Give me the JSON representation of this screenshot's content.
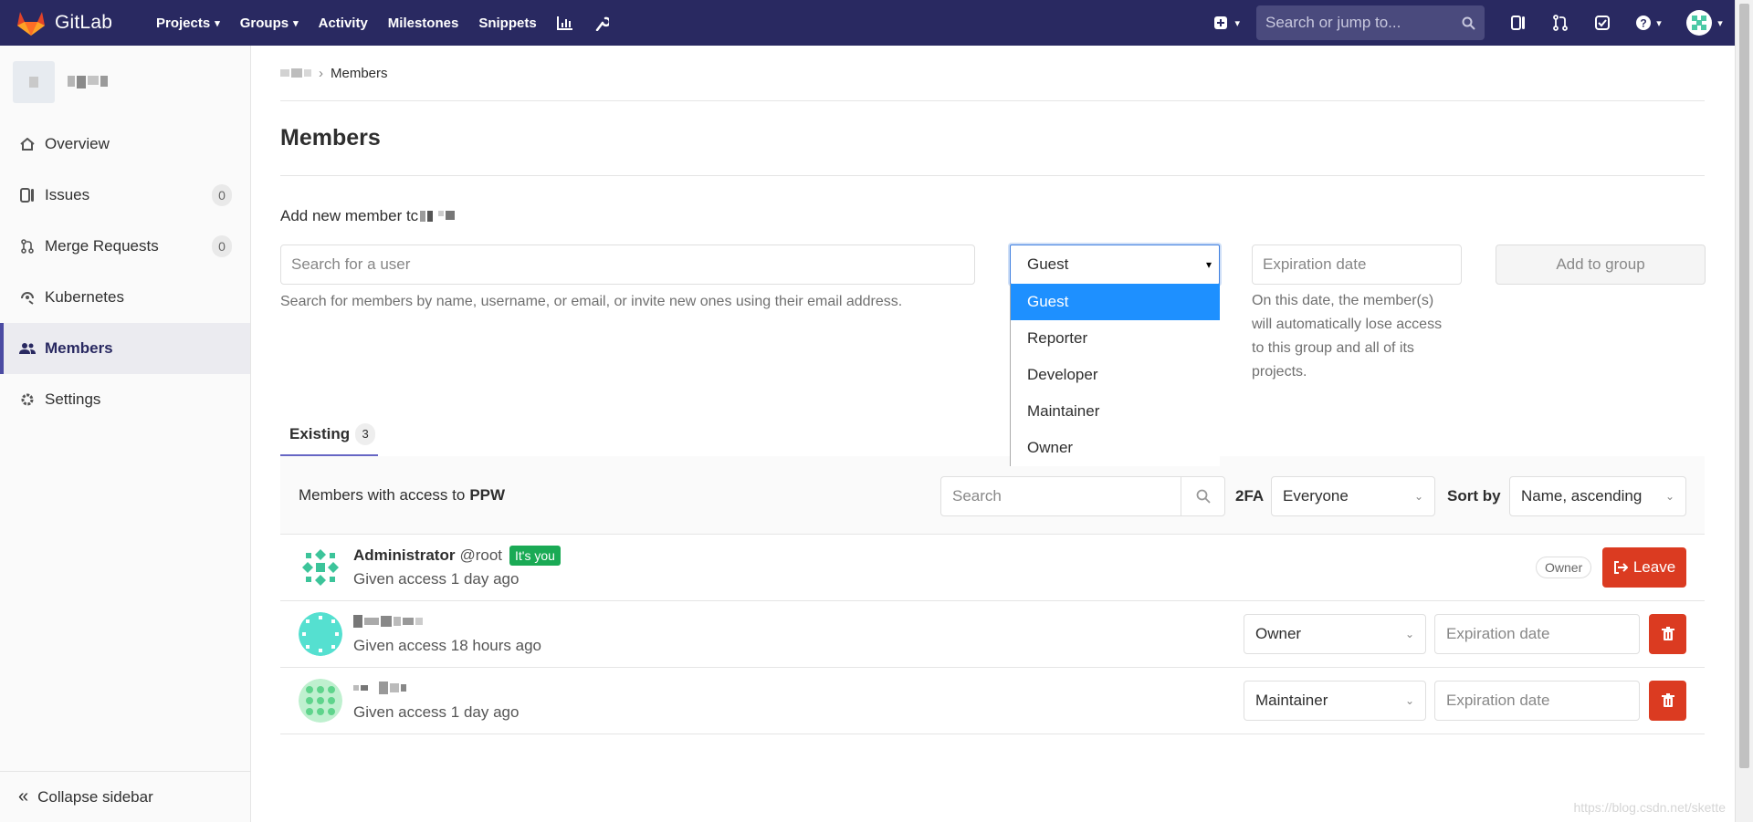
{
  "navbar": {
    "brand": "GitLab",
    "links": [
      {
        "label": "Projects",
        "caret": true
      },
      {
        "label": "Groups",
        "caret": true
      },
      {
        "label": "Activity",
        "caret": false
      },
      {
        "label": "Milestones",
        "caret": false
      },
      {
        "label": "Snippets",
        "caret": false
      }
    ],
    "search_placeholder": "Search or jump to..."
  },
  "sidebar": {
    "items": [
      {
        "label": "Overview",
        "icon": "home-icon"
      },
      {
        "label": "Issues",
        "icon": "issues-icon",
        "count": "0"
      },
      {
        "label": "Merge Requests",
        "icon": "merge-request-icon",
        "count": "0"
      },
      {
        "label": "Kubernetes",
        "icon": "kubernetes-icon"
      },
      {
        "label": "Members",
        "icon": "users-icon",
        "active": true
      },
      {
        "label": "Settings",
        "icon": "settings-icon"
      }
    ],
    "collapse_label": "Collapse sidebar"
  },
  "breadcrumb": {
    "current": "Members"
  },
  "page": {
    "title": "Members",
    "add_label": "Add new member tc",
    "search_user_placeholder": "Search for a user",
    "search_hint": "Search for members by name, username, or email, or invite new ones using their email address.",
    "role_selected": "Guest",
    "role_options": [
      "Guest",
      "Reporter",
      "Developer",
      "Maintainer",
      "Owner"
    ],
    "expiration_placeholder": "Expiration date",
    "expiration_hint": [
      "On this date, the member(s)",
      "will automatically lose access",
      "to this group and all of its",
      "projects."
    ],
    "add_button": "Add to group"
  },
  "tabs": [
    {
      "label": "Existing",
      "count": "3"
    }
  ],
  "panel": {
    "title_prefix": "Members with access to",
    "group_name": "PPW",
    "search_placeholder": "Search",
    "twofa_label": "2FA",
    "twofa_value": "Everyone",
    "sort_label": "Sort by",
    "sort_value": "Name, ascending"
  },
  "members": [
    {
      "name": "Administrator",
      "username": "@root",
      "badge": "It's you",
      "access": "Given access 1 day ago",
      "role_badge": "Owner",
      "action": "Leave"
    },
    {
      "name": "",
      "access": "Given access 18 hours ago",
      "role": "Owner",
      "expiration_placeholder": "Expiration date"
    },
    {
      "name": "",
      "access": "Given access 1 day ago",
      "role": "Maintainer",
      "expiration_placeholder": "Expiration date"
    }
  ],
  "watermark": "https://blog.csdn.net/skette",
  "colors": {
    "navbar": "#292961",
    "accent": "#6666c4",
    "danger": "#db3b21",
    "success": "#1aaa55",
    "select_highlight": "#1e90ff"
  }
}
